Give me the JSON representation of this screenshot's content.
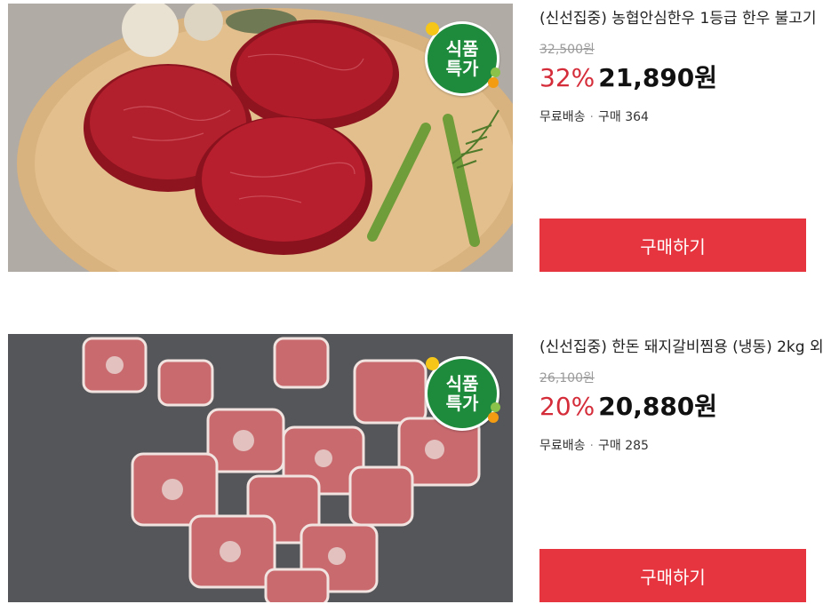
{
  "products": [
    {
      "title": "(신선집중) 농협안심한우 1등급 한우 불고기",
      "badge_line1": "식품",
      "badge_line2": "특가",
      "original_price": "32,500원",
      "discount": "32%",
      "price": "21,890원",
      "shipping": "무료배송",
      "purchases": "구매 364",
      "buy_label": "구매하기",
      "colors": {
        "discount": "#d52c3a",
        "button": "#e7353f",
        "badge": "#1e8a3c"
      }
    },
    {
      "title": "(신선집중) 한돈 돼지갈비찜용 (냉동) 2kg 외",
      "badge_line1": "식품",
      "badge_line2": "특가",
      "original_price": "26,100원",
      "discount": "20%",
      "price": "20,880원",
      "shipping": "무료배송",
      "purchases": "구매 285",
      "buy_label": "구매하기",
      "colors": {
        "discount": "#d52c3a",
        "button": "#e7353f",
        "badge": "#1e8a3c"
      }
    }
  ]
}
